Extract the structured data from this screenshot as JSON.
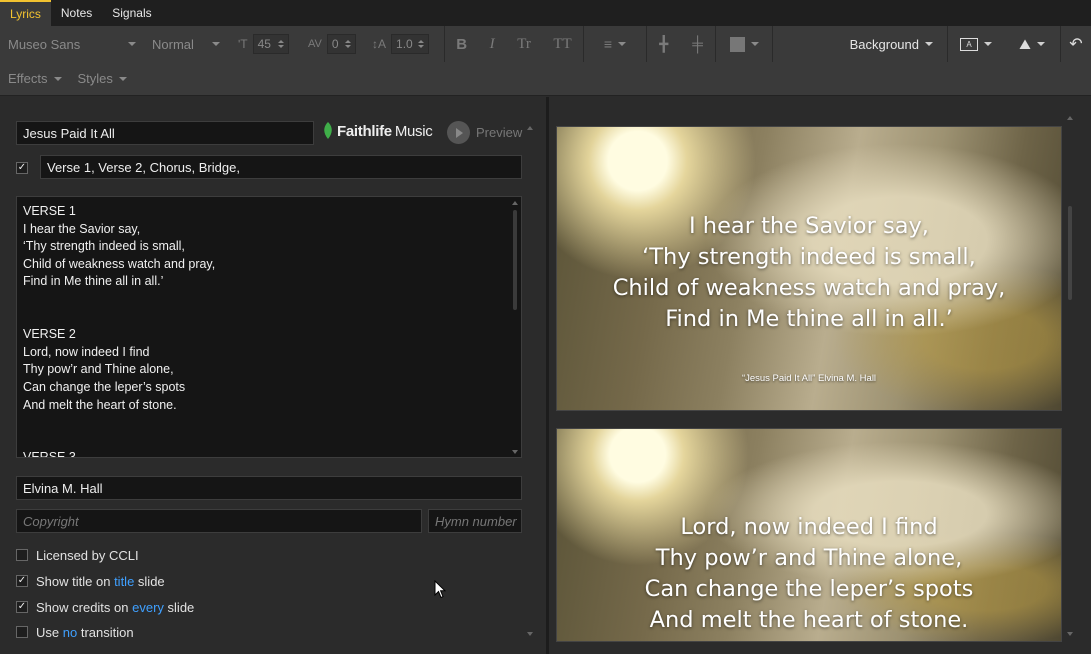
{
  "tabs": [
    {
      "label": "Lyrics",
      "active": true
    },
    {
      "label": "Notes",
      "active": false
    },
    {
      "label": "Signals",
      "active": false
    }
  ],
  "toolbar": {
    "font_family": "Museo Sans",
    "font_weight": "Normal",
    "font_size": "45",
    "tracking": "0",
    "line_spacing": "1.0",
    "background_label": "Background",
    "effects_label": "Effects",
    "styles_label": "Styles"
  },
  "editor": {
    "song_title": "Jesus Paid It All",
    "logo_bold": "Faithlife",
    "logo_light": "Music",
    "preview_label": "Preview",
    "sections_value": "Verse 1, Verse 2, Chorus, Bridge,",
    "sections_checked": true,
    "lyrics_text": "VERSE 1\nI hear the Savior say,\n‘Thy strength indeed is small,\nChild of weakness watch and pray,\nFind in Me thine all in all.’\n\n\nVERSE 2\nLord, now indeed I find\nThy pow’r and Thine alone,\nCan change the leper’s spots\nAnd melt the heart of stone.\n\n\nVERSE 3",
    "author": "Elvina M. Hall",
    "copyright_placeholder": "Copyright",
    "hymn_placeholder": "Hymn number",
    "options": {
      "licensed": {
        "label": "Licensed by CCLI",
        "checked": false
      },
      "show_title": {
        "prefix": "Show title on",
        "link": "title",
        "suffix": "slide",
        "checked": true
      },
      "show_credits": {
        "prefix": "Show credits on",
        "link": "every",
        "suffix": "slide",
        "checked": true
      },
      "transition": {
        "prefix": "Use",
        "link": "no",
        "suffix": "transition",
        "checked": false
      }
    }
  },
  "slides": [
    {
      "lines": [
        "I hear the Savior say,",
        "‘Thy strength indeed is small,",
        "Child of weakness watch and pray,",
        "Find in Me thine all in all.’"
      ],
      "credit": "“Jesus Paid It All” Elvina M. Hall"
    },
    {
      "lines": [
        "Lord, now indeed I find",
        "Thy pow’r and Thine alone,",
        "Can change the leper’s spots",
        "And melt the heart of stone."
      ],
      "credit": ""
    }
  ],
  "colors": {
    "accent": "#f2c230",
    "link": "#3fa0ff"
  }
}
